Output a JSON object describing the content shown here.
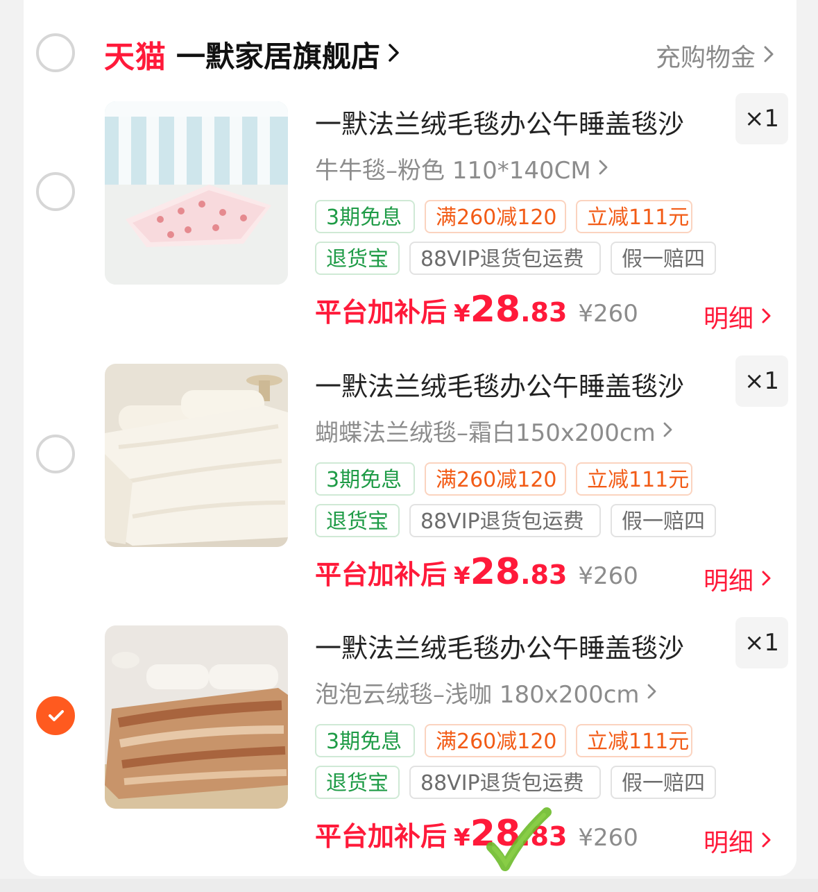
{
  "store": {
    "platform": "天猫",
    "name": "一默家居旗舰店",
    "coupon_label": "充购物金"
  },
  "items": [
    {
      "title": "一默法兰绒毛毯办公午睡盖毯沙",
      "qty": "×1",
      "sku": "牛牛毯–粉色 110*140CM",
      "tags": [
        "3期免息",
        "满260减120",
        "立减111元",
        "退货宝",
        "88VIP退货包运费",
        "假一赔四"
      ],
      "price_label": "平台加补后",
      "price_yen": "¥",
      "price_int": "28",
      "price_dec": ".83",
      "orig_price": "¥260",
      "detail_label": "明细",
      "selected": false
    },
    {
      "title": "一默法兰绒毛毯办公午睡盖毯沙",
      "qty": "×1",
      "sku": "蝴蝶法兰绒毯–霜白150x200cm",
      "tags": [
        "3期免息",
        "满260减120",
        "立减111元",
        "退货宝",
        "88VIP退货包运费",
        "假一赔四"
      ],
      "price_label": "平台加补后",
      "price_yen": "¥",
      "price_int": "28",
      "price_dec": ".83",
      "orig_price": "¥260",
      "detail_label": "明细",
      "selected": false
    },
    {
      "title": "一默法兰绒毛毯办公午睡盖毯沙",
      "qty": "×1",
      "sku": "泡泡云绒毯–浅咖 180x200cm",
      "tags": [
        "3期免息",
        "满260减120",
        "立减111元",
        "退货宝",
        "88VIP退货包运费",
        "假一赔四"
      ],
      "price_label": "平台加补后",
      "price_yen": "¥",
      "price_int": "28",
      "price_dec": ".83",
      "orig_price": "¥260",
      "detail_label": "明细",
      "selected": true
    }
  ],
  "colors": {
    "brand_red": "#ff1a3a",
    "select_orange": "#ff5a1f",
    "tag_green": "#1e9b46",
    "tag_orange": "#f25b16"
  }
}
